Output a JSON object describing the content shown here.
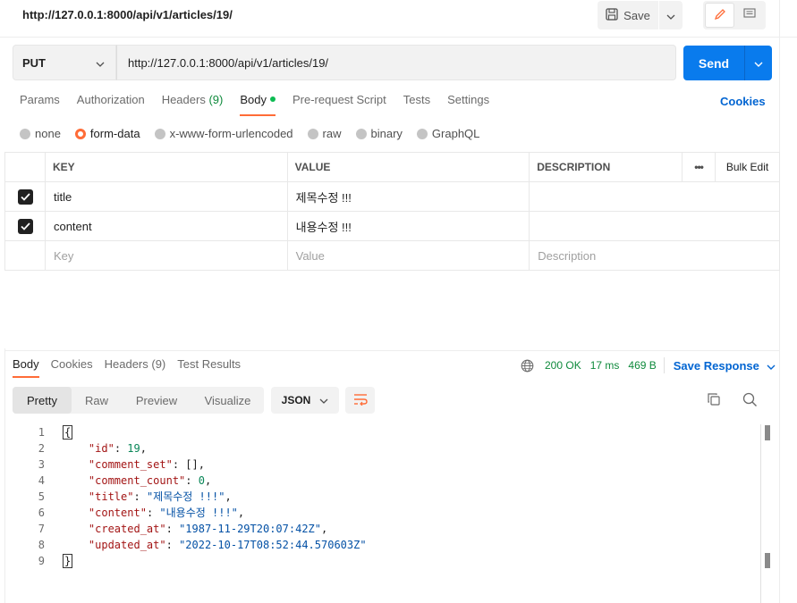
{
  "request": {
    "title": "http://127.0.0.1:8000/api/v1/articles/19/",
    "method": "PUT",
    "url": "http://127.0.0.1:8000/api/v1/articles/19/"
  },
  "toolbar": {
    "save_label": "Save",
    "save_icon": "save-icon",
    "edit_icon": "pencil-icon",
    "comment_icon": "comment-icon"
  },
  "send": {
    "label": "Send"
  },
  "request_tabs": [
    {
      "label": "Params"
    },
    {
      "label": "Authorization"
    },
    {
      "label": "Headers",
      "count": "(9)"
    },
    {
      "label": "Body"
    },
    {
      "label": "Pre-request Script"
    },
    {
      "label": "Tests"
    },
    {
      "label": "Settings"
    }
  ],
  "cookies_label": "Cookies",
  "body_types": [
    "none",
    "form-data",
    "x-www-form-urlencoded",
    "raw",
    "binary",
    "GraphQL"
  ],
  "body_type_selected": "form-data",
  "kv_table": {
    "headers": {
      "key": "KEY",
      "value": "VALUE",
      "description": "DESCRIPTION",
      "more": "•••",
      "bulk": "Bulk Edit"
    },
    "rows": [
      {
        "key": "title",
        "value": "제목수정 !!!",
        "description": "",
        "checked": true
      },
      {
        "key": "content",
        "value": "내용수정 !!!",
        "description": "",
        "checked": true
      }
    ],
    "placeholders": {
      "key": "Key",
      "value": "Value",
      "description": "Description"
    }
  },
  "response_tabs": [
    {
      "label": "Body"
    },
    {
      "label": "Cookies"
    },
    {
      "label": "Headers (9)"
    },
    {
      "label": "Test Results"
    }
  ],
  "response_meta": {
    "status": "200 OK",
    "time": "17 ms",
    "size": "469 B",
    "save_response": "Save Response"
  },
  "view_modes": [
    "Pretty",
    "Raw",
    "Preview",
    "Visualize"
  ],
  "format": "JSON",
  "code_lines": [
    "1",
    "2",
    "3",
    "4",
    "5",
    "6",
    "7",
    "8",
    "9"
  ],
  "json_body": {
    "open": "{",
    "id_key": "\"id\"",
    "id_val": "19",
    "comment_set_key": "\"comment_set\"",
    "comment_set_val": "[]",
    "comment_count_key": "\"comment_count\"",
    "comment_count_val": "0",
    "title_key": "\"title\"",
    "title_val": "\"제목수정 !!!\"",
    "content_key": "\"content\"",
    "content_val": "\"내용수정 !!!\"",
    "created_at_key": "\"created_at\"",
    "created_at_val": "\"1987-11-29T20:07:42Z\"",
    "updated_at_key": "\"updated_at\"",
    "updated_at_val": "\"2022-10-17T08:52:44.570603Z\"",
    "close": "}"
  },
  "colors": {
    "accent": "#ff6c37",
    "send_blue": "#097bed",
    "link_blue": "#0265d2",
    "status_green": "#0f8a3c",
    "dot_green": "#0cbb52"
  }
}
